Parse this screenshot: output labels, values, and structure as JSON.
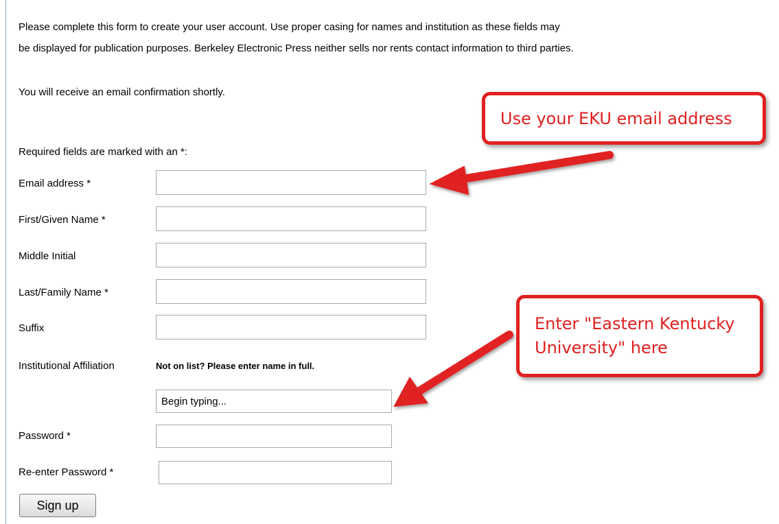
{
  "intro": {
    "line1": "Please complete this form to create your user account. Use proper casing for names and institution as these fields may",
    "line2": "be displayed for publication purposes. Berkeley Electronic Press neither sells nor rents contact information to third parties."
  },
  "notice": "You will receive an email confirmation shortly.",
  "required_note": "Required fields are marked with an *:",
  "fields": {
    "email": {
      "label": "Email address *",
      "value": ""
    },
    "first_name": {
      "label": "First/Given Name *",
      "value": ""
    },
    "middle_initial": {
      "label": "Middle Initial",
      "value": ""
    },
    "last_name": {
      "label": "Last/Family Name *",
      "value": ""
    },
    "suffix": {
      "label": "Suffix",
      "value": ""
    },
    "institution": {
      "label": "Institutional Affiliation",
      "hint": "Not on list? Please enter name in full.",
      "value": "Begin typing..."
    },
    "password": {
      "label": "Password *",
      "value": ""
    },
    "password_confirm": {
      "label": "Re-enter Password *",
      "value": ""
    }
  },
  "signup_button": "Sign up",
  "callouts": {
    "email": "Use your EKU email address",
    "institution_line1": "Enter \"Eastern Kentucky",
    "institution_line2": "University\" here"
  },
  "colors": {
    "callout": "#e02020",
    "border": "#7f9db9"
  },
  "icons": {
    "arrow": "arrow-icon"
  }
}
